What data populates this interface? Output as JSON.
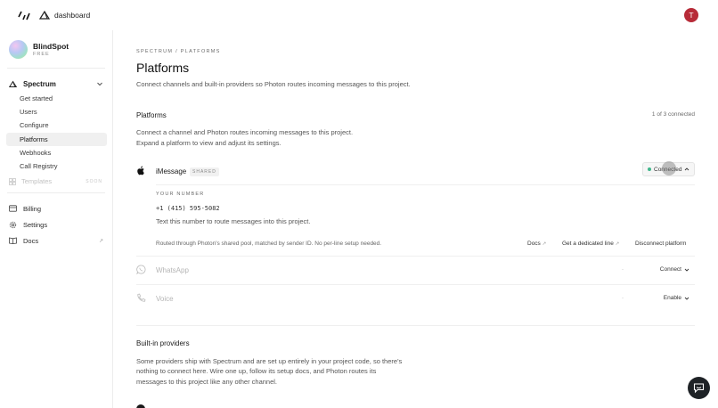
{
  "topbar": {
    "dashboard_label": "dashboard",
    "user_initial": "T"
  },
  "sidebar": {
    "workspace": {
      "name": "BlindSpot",
      "plan": "FREE"
    },
    "group": {
      "label": "Spectrum",
      "icon": "spectrum-icon"
    },
    "items": [
      {
        "label": "Get started"
      },
      {
        "label": "Users"
      },
      {
        "label": "Configure"
      },
      {
        "label": "Platforms",
        "active": true
      },
      {
        "label": "Webhooks"
      },
      {
        "label": "Call Registry"
      }
    ],
    "templates": {
      "label": "Templates",
      "badge": "SOON"
    },
    "bottom": [
      {
        "label": "Billing",
        "icon": "card-icon"
      },
      {
        "label": "Settings",
        "icon": "gear-icon"
      },
      {
        "label": "Docs",
        "icon": "book-icon",
        "ext": "↗"
      }
    ]
  },
  "main": {
    "breadcrumb": "SPECTRUM / PLATFORMS",
    "title": "Platforms",
    "subtitle": "Connect channels and built-in providers so Photon routes incoming messages to this project.",
    "platforms_section": {
      "title": "Platforms",
      "count": "1 of 3 connected",
      "desc_line1": "Connect a channel and Photon routes incoming messages to this project.",
      "desc_line2": "Expand a platform to view and adjust its settings."
    },
    "imessage": {
      "name": "iMessage",
      "badge": "SHARED",
      "status": "Connected",
      "number_label": "YOUR NUMBER",
      "number": "+1 (415) 595-5082",
      "number_desc": "Text this number to route messages into this project.",
      "routed": "Routed through Photon's shared pool, matched by sender ID. No per-line setup needed.",
      "docs": "Docs",
      "dedicated": "Get a dedicated line",
      "disconnect": "Disconnect platform"
    },
    "whatsapp": {
      "name": "WhatsApp",
      "dash": "-",
      "action": "Connect"
    },
    "voice": {
      "name": "Voice",
      "dash": "-",
      "action": "Enable"
    },
    "builtin": {
      "title": "Built-in providers",
      "desc1": "Some providers ship with Spectrum and are set up entirely in your project code, so there's",
      "desc2": "nothing to connect here. Wire one up, follow its setup docs, and Photon routes its",
      "desc3": "messages to this project like any other channel."
    }
  },
  "colors": {
    "accent_status": "#3fb68b",
    "user_avatar": "#b72b38"
  }
}
